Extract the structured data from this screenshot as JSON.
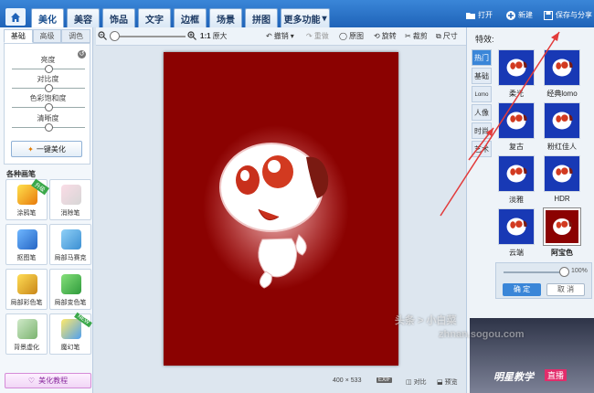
{
  "titlebar": {
    "tabs": [
      "美化",
      "美容",
      "饰品",
      "文字",
      "边框",
      "场景",
      "拼图",
      "更多功能"
    ],
    "active_tab": "美化",
    "more_arrow": "▾",
    "actions": {
      "open": "打开",
      "new": "新建",
      "save_share": "保存与分享"
    }
  },
  "toolbar": {
    "zoom_label": "1:1",
    "original_size": "原大",
    "undo": "撤销",
    "redo": "重做",
    "compare_original": "原图",
    "rotate": "旋转",
    "crop": "裁剪",
    "size": "尺寸",
    "zoom_level": 0.05
  },
  "left_panel": {
    "tabs": [
      "基础",
      "高级",
      "调色"
    ],
    "active_tab": "基础",
    "sliders": [
      {
        "label": "亮度",
        "value": 0.5
      },
      {
        "label": "对比度",
        "value": 0.5
      },
      {
        "label": "色彩饱和度",
        "value": 0.5
      },
      {
        "label": "清晰度",
        "value": 0.5
      }
    ],
    "one_key_beautify": "一键美化",
    "brushes_title": "各种画笔",
    "brushes": [
      {
        "label": "涂鸦笔",
        "badge": "升级"
      },
      {
        "label": "消除笔",
        "badge": ""
      },
      {
        "label": "抠图笔",
        "badge": ""
      },
      {
        "label": "局部马赛克",
        "badge": ""
      },
      {
        "label": "局部彩色笔",
        "badge": ""
      },
      {
        "label": "局部变色笔",
        "badge": ""
      },
      {
        "label": "背景虚化",
        "badge": ""
      },
      {
        "label": "魔幻笔",
        "badge": "NEW"
      }
    ],
    "tutorial": "美化教程"
  },
  "canvas": {
    "image_width": "400",
    "image_height": "533",
    "times": "×",
    "exif": "EXIF",
    "compare": "对比",
    "preview": "预览",
    "photo_bg": "#8b0201"
  },
  "right_panel": {
    "title": "特效:",
    "categories": [
      "热门",
      "基础",
      "Lomo",
      "人像",
      "时尚",
      "艺术"
    ],
    "active_category": "热门",
    "effects": [
      {
        "label": "柔光"
      },
      {
        "label": "经典lomo"
      },
      {
        "label": "复古"
      },
      {
        "label": "粉红佳人"
      },
      {
        "label": "淡雅"
      },
      {
        "label": "HDR"
      },
      {
        "label": "云端"
      },
      {
        "label": "阿宝色"
      }
    ],
    "selected_effect": "阿宝色",
    "opacity_value": "100%",
    "opacity_level": 1.0,
    "ok": "确 定",
    "cancel": "取 消",
    "ad_text": "明星教学",
    "ad_badge": "直播"
  },
  "watermark": {
    "line1": "头条 > 小白菜",
    "line2": "zhnan.sogou.com"
  },
  "colors": {
    "accent": "#3a86d8",
    "titlebar": "#1f63b8",
    "photo_bg": "#8b0201",
    "thumb_blue": "#1839b5"
  }
}
